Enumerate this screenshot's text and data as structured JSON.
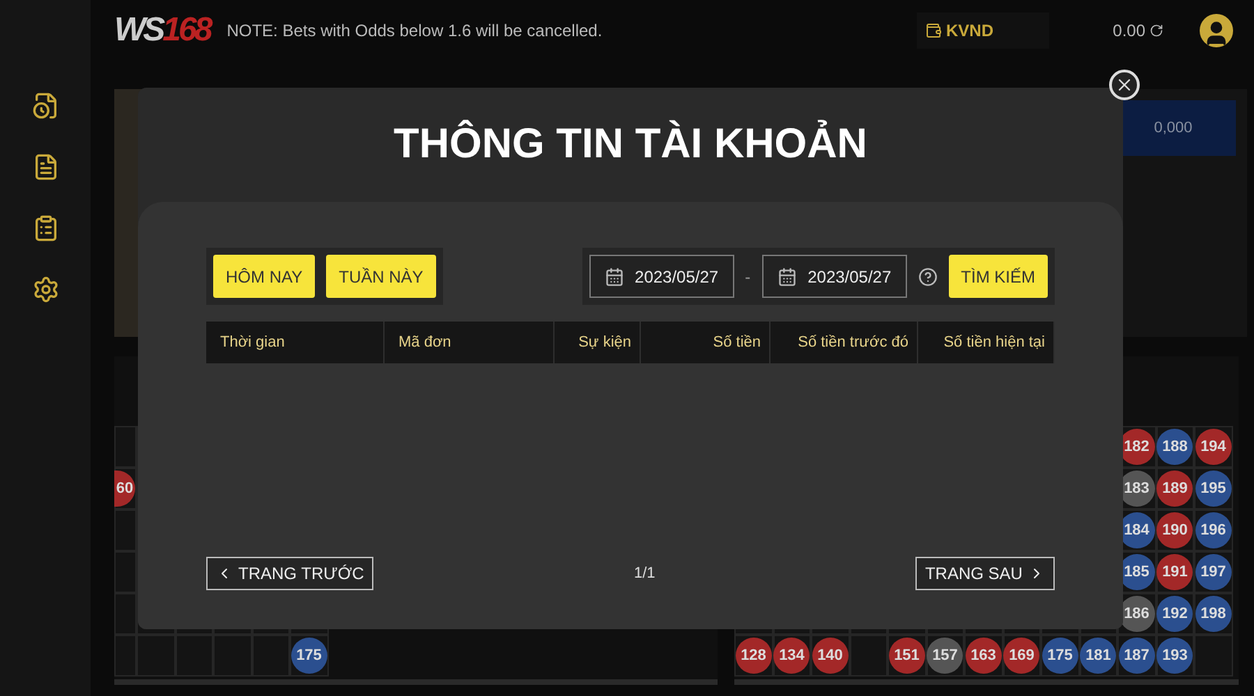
{
  "header": {
    "logo": "WS168",
    "note": "NOTE: Bets with Odds below 1.6 will be cancelled.",
    "currency": "KVND",
    "balance": "0.00"
  },
  "stage": {
    "amount": "0,000"
  },
  "left_board": {
    "columns": [
      [
        null,
        {
          "n": "60",
          "color": "#a32828"
        },
        null,
        null,
        null,
        null
      ],
      [
        null,
        null,
        null,
        null,
        null,
        null
      ],
      [
        null,
        null,
        null,
        null,
        null,
        null
      ],
      [
        null,
        null,
        null,
        null,
        null,
        null
      ],
      [
        null,
        null,
        null,
        null,
        null,
        null
      ],
      [
        null,
        null,
        null,
        null,
        null,
        {
          "n": "175",
          "color": "#2b4f8f"
        }
      ]
    ]
  },
  "right_board": {
    "columns": [
      [
        null,
        null,
        null,
        null,
        null,
        {
          "n": "128",
          "color": "#a32828"
        }
      ],
      [
        null,
        null,
        null,
        null,
        null,
        {
          "n": "134",
          "color": "#a32828"
        }
      ],
      [
        null,
        null,
        null,
        null,
        null,
        {
          "n": "140",
          "color": "#a32828"
        }
      ],
      [
        null,
        null,
        null,
        null,
        null,
        null
      ],
      [
        null,
        null,
        null,
        null,
        null,
        {
          "n": "151",
          "color": "#a32828"
        }
      ],
      [
        null,
        null,
        null,
        null,
        null,
        {
          "n": "157",
          "color": "#555555"
        }
      ],
      [
        null,
        null,
        null,
        null,
        null,
        {
          "n": "163",
          "color": "#a32828"
        }
      ],
      [
        null,
        null,
        null,
        null,
        null,
        {
          "n": "169",
          "color": "#a32828"
        }
      ],
      [
        null,
        null,
        null,
        null,
        null,
        {
          "n": "175",
          "color": "#2b4f8f"
        }
      ],
      [
        null,
        null,
        null,
        null,
        null,
        {
          "n": "181",
          "color": "#2b4f8f"
        }
      ],
      [
        {
          "n": "182",
          "color": "#a32828"
        },
        {
          "n": "183",
          "color": "#555555"
        },
        {
          "n": "184",
          "color": "#2b4f8f"
        },
        {
          "n": "185",
          "color": "#2b4f8f"
        },
        {
          "n": "186",
          "color": "#555555"
        },
        {
          "n": "187",
          "color": "#2b4f8f"
        }
      ],
      [
        {
          "n": "188",
          "color": "#2b4f8f"
        },
        {
          "n": "189",
          "color": "#a32828"
        },
        {
          "n": "190",
          "color": "#a32828"
        },
        {
          "n": "191",
          "color": "#a32828"
        },
        {
          "n": "192",
          "color": "#2b4f8f"
        },
        {
          "n": "193",
          "color": "#2b4f8f"
        }
      ],
      [
        {
          "n": "194",
          "color": "#a32828"
        },
        {
          "n": "195",
          "color": "#2b4f8f"
        },
        {
          "n": "196",
          "color": "#2b4f8f"
        },
        {
          "n": "197",
          "color": "#2b4f8f"
        },
        {
          "n": "198",
          "color": "#2b4f8f"
        },
        null
      ]
    ]
  },
  "dialog": {
    "title": "THÔNG TIN TÀI KHOẢN",
    "quick_filters": [
      "HÔM NAY",
      "TUẦN NÀY"
    ],
    "date_from": "2023/05/27",
    "separator": "-",
    "date_to": "2023/05/27",
    "search_button": "TÌM KIẾM",
    "table": {
      "columns": [
        "Thời gian",
        "Mã đơn",
        "Sự kiện",
        "Số tiền",
        "Số tiền trước đó",
        "Số tiền hiện tại"
      ]
    },
    "prev_button": "TRANG TRƯỚC",
    "page": "1/1",
    "next_button": "TRANG SAU"
  }
}
